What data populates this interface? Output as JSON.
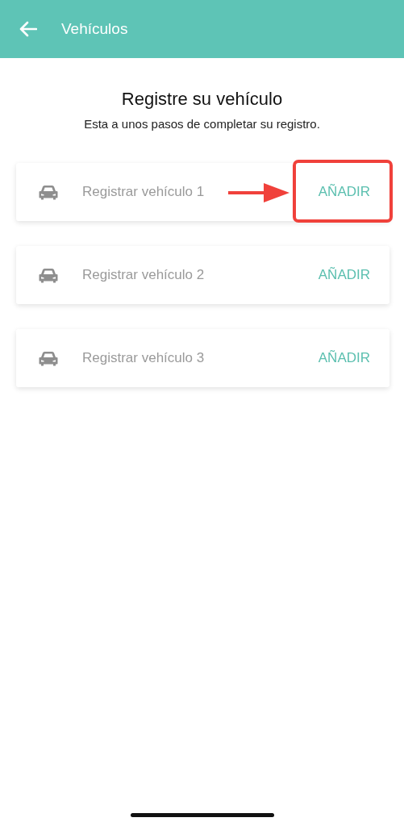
{
  "header": {
    "title": "Vehículos"
  },
  "heading": "Registre su vehículo",
  "subheading": "Esta a unos pasos de completar su registro.",
  "vehicles": [
    {
      "label": "Registrar vehículo 1",
      "action": "AÑADIR",
      "highlighted": true
    },
    {
      "label": "Registrar vehículo 2",
      "action": "AÑADIR",
      "highlighted": false
    },
    {
      "label": "Registrar vehículo 3",
      "action": "AÑADIR",
      "highlighted": false
    }
  ]
}
